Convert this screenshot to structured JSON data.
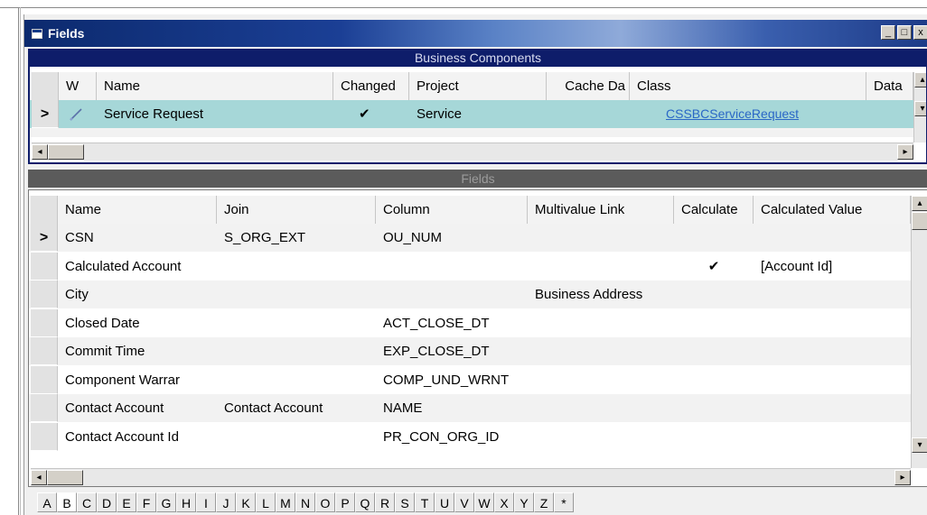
{
  "window": {
    "title": "Fields",
    "controls": [
      "_",
      "□",
      "x"
    ]
  },
  "business_components": {
    "section_title": "Business Components",
    "columns": [
      "W",
      "Name",
      "Changed",
      "Project",
      "Cache Da",
      "Class",
      "Data"
    ],
    "rows": [
      {
        "indicator": ">",
        "name": "Service Request",
        "changed": "✔",
        "project": "Service",
        "cache_da": "",
        "class": "CSSBCServiceRequest",
        "data": ""
      }
    ]
  },
  "fields": {
    "section_title": "Fields",
    "columns": [
      "Name",
      "Join",
      "Column",
      "Multivalue Link",
      "Calculate",
      "Calculated Value"
    ],
    "rows": [
      {
        "indicator": ">",
        "name": "CSN",
        "join": "S_ORG_EXT",
        "column": "OU_NUM",
        "multivalue_link": "",
        "calculate": "",
        "calculated_value": ""
      },
      {
        "indicator": "",
        "name": "Calculated Account",
        "join": "",
        "column": "",
        "multivalue_link": "",
        "calculate": "✔",
        "calculated_value": "[Account Id]"
      },
      {
        "indicator": "",
        "name": "City",
        "join": "",
        "column": "",
        "multivalue_link": "Business Address",
        "calculate": "",
        "calculated_value": ""
      },
      {
        "indicator": "",
        "name": "Closed Date",
        "join": "",
        "column": "ACT_CLOSE_DT",
        "multivalue_link": "",
        "calculate": "",
        "calculated_value": ""
      },
      {
        "indicator": "",
        "name": "Commit Time",
        "join": "",
        "column": "EXP_CLOSE_DT",
        "multivalue_link": "",
        "calculate": "",
        "calculated_value": ""
      },
      {
        "indicator": "",
        "name": "Component Warrar",
        "join": "",
        "column": "COMP_UND_WRNT",
        "multivalue_link": "",
        "calculate": "",
        "calculated_value": ""
      },
      {
        "indicator": "",
        "name": "Contact Account",
        "join": "Contact Account",
        "column": "NAME",
        "multivalue_link": "",
        "calculate": "",
        "calculated_value": ""
      },
      {
        "indicator": "",
        "name": "Contact Account Id",
        "join": "",
        "column": "PR_CON_ORG_ID",
        "multivalue_link": "",
        "calculate": "",
        "calculated_value": ""
      }
    ]
  },
  "alphabet": {
    "letters": [
      "A",
      "B",
      "C",
      "D",
      "E",
      "F",
      "G",
      "H",
      "I",
      "J",
      "K",
      "L",
      "M",
      "N",
      "O",
      "P",
      "Q",
      "R",
      "S",
      "T",
      "U",
      "V",
      "W",
      "X",
      "Y",
      "Z",
      "*"
    ],
    "active": "B"
  },
  "icons": {
    "edit": "pencil-icon",
    "scroll_left": "◂",
    "scroll_right": "▸",
    "scroll_up": "▴",
    "scroll_down": "▾"
  },
  "colors": {
    "selected_row": "#a6d7d8",
    "section_header": "#0e1d6a",
    "link": "#2a67c6"
  }
}
